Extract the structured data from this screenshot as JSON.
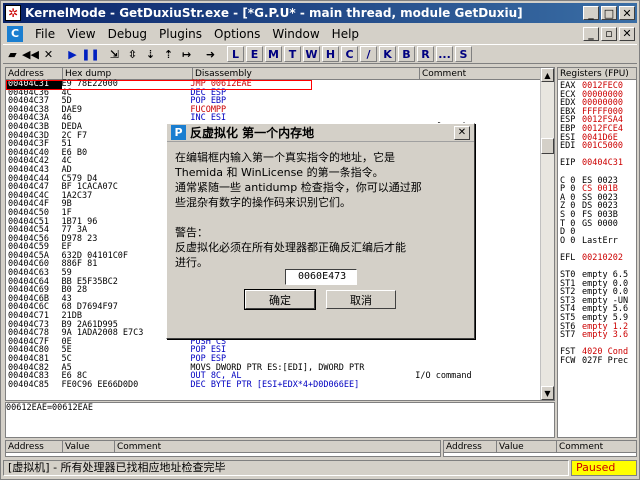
{
  "title": "KernelMode - GetDuxiuStr.exe - [*G.P.U* - main thread, module GetDuxiu]",
  "menu": [
    "File",
    "View",
    "Debug",
    "Plugins",
    "Options",
    "Window",
    "Help"
  ],
  "toolbar_letters": [
    "L",
    "E",
    "M",
    "T",
    "W",
    "H",
    "C",
    "/",
    "K",
    "B",
    "R",
    "...",
    "S"
  ],
  "cpu_headers": {
    "address": "Address",
    "hex": "Hex dump",
    "disasm": "Disassembly",
    "comment": "Comment"
  },
  "cpu_rows": [
    {
      "a": "00404C31",
      "h": "E9 78E22000",
      "d": "JMP 00612EAE",
      "c": "",
      "sel": true,
      "dc": "red"
    },
    {
      "a": "00404C36",
      "h": "4C",
      "d": "DEC ESP",
      "c": "",
      "dc": "blu"
    },
    {
      "a": "00404C37",
      "h": "5D",
      "d": "POP EBP",
      "c": "",
      "dc": "blu"
    },
    {
      "a": "00404C38",
      "h": "DAE9",
      "d": "FUCOMPP",
      "c": "",
      "dc": "red"
    },
    {
      "a": "00404C3A",
      "h": "46",
      "d": "INC ESI",
      "c": "",
      "dc": "blu"
    },
    {
      "a": "00404C3B",
      "h": "DEDA",
      "d": "",
      "c": "se of regi",
      "dc": ""
    },
    {
      "a": "00404C3D",
      "h": "2C F7",
      "d": "",
      "c": "",
      "dc": ""
    },
    {
      "a": "00404C3F",
      "h": "51",
      "d": "",
      "c": "",
      "dc": ""
    },
    {
      "a": "00404C40",
      "h": "E6 B0",
      "d": "",
      "c": "nd",
      "dc": ""
    },
    {
      "a": "00404C42",
      "h": "4C",
      "d": "",
      "c": "",
      "dc": ""
    },
    {
      "a": "00404C43",
      "h": "AD",
      "d": "",
      "c": "",
      "dc": ""
    },
    {
      "a": "00404C44",
      "h": "C579 D4",
      "d": "",
      "c": "ion of seg",
      "dc": ""
    },
    {
      "a": "00404C47",
      "h": "BF 1CACA07C",
      "d": "",
      "c": "",
      "dc": ""
    },
    {
      "a": "00404C4C",
      "h": "1A2C37",
      "d": "",
      "c": "ion of seg",
      "dc": ""
    },
    {
      "a": "00404C4F",
      "h": "9B",
      "d": "",
      "c": "",
      "dc": ""
    },
    {
      "a": "00404C50",
      "h": "1F",
      "d": "",
      "c": "",
      "dc": ""
    },
    {
      "a": "00404C51",
      "h": "1B71 96",
      "d": "",
      "c": "",
      "dc": ""
    },
    {
      "a": "00404C54",
      "h": "77 3A",
      "d": "",
      "c": "",
      "dc": ""
    },
    {
      "a": "00404C56",
      "h": "D978 23",
      "d": "",
      "c": "",
      "dc": ""
    },
    {
      "a": "00404C59",
      "h": "EF",
      "d": "",
      "c": "nd",
      "dc": ""
    },
    {
      "a": "00404C5A",
      "h": "632D 04101C0F",
      "d": "",
      "c": "",
      "dc": ""
    },
    {
      "a": "00404C60",
      "h": "886F 81",
      "d": "",
      "c": "",
      "dc": ""
    },
    {
      "a": "00404C63",
      "h": "59",
      "d": "",
      "c": "",
      "dc": ""
    },
    {
      "a": "00404C64",
      "h": "BB E5F35BC2",
      "d": "",
      "c": "",
      "dc": ""
    },
    {
      "a": "00404C69",
      "h": "B0 28",
      "d": "",
      "c": "",
      "dc": ""
    },
    {
      "a": "00404C6B",
      "h": "43",
      "d": "",
      "c": "",
      "dc": ""
    },
    {
      "a": "00404C6C",
      "h": "68 D7694F97",
      "d": "",
      "c": "",
      "dc": ""
    },
    {
      "a": "00404C71",
      "h": "21DB",
      "d": "",
      "c": "",
      "dc": ""
    },
    {
      "a": "00404C73",
      "h": "B9 2A61D995",
      "d": "",
      "c": "",
      "dc": ""
    },
    {
      "a": "00404C78",
      "h": "9A 1ADA2008 E7C3",
      "d": "CALL FAR C3E7:0820DA1A",
      "c": "Far call",
      "dc": "call"
    },
    {
      "a": "00404C7F",
      "h": "0E",
      "d": "PUSH CS",
      "c": "",
      "dc": "blu"
    },
    {
      "a": "00404C80",
      "h": "5E",
      "d": "POP ESI",
      "c": "",
      "dc": "blu"
    },
    {
      "a": "00404C81",
      "h": "5C",
      "d": "POP ESP",
      "c": "",
      "dc": "blu"
    },
    {
      "a": "00404C82",
      "h": "A5",
      "d": "MOVS DWORD PTR ES:[EDI], DWORD PTR",
      "c": "",
      "dc": ""
    },
    {
      "a": "00404C83",
      "h": "E6 8C",
      "d": "OUT 8C, AL",
      "c": "I/O command",
      "dc": "blu"
    },
    {
      "a": "00404C85",
      "h": "FE0C96 EE66D0D0",
      "d": "DEC BYTE PTR [ESI+EDX*4+D0D066EE]",
      "c": "",
      "dc": "blu"
    }
  ],
  "info_line": "00612EAE=00612EAE",
  "registers_title": "Registers (FPU)",
  "registers": [
    {
      "n": "EAX",
      "v": "0012FEC0",
      "color": "red"
    },
    {
      "n": "ECX",
      "v": "00000000",
      "color": "red"
    },
    {
      "n": "EDX",
      "v": "00000000",
      "color": "red"
    },
    {
      "n": "EBX",
      "v": "FFFFF000",
      "color": "red"
    },
    {
      "n": "ESP",
      "v": "0012FSA4",
      "color": "red"
    },
    {
      "n": "EBP",
      "v": "0012FCE4",
      "color": "red"
    },
    {
      "n": "ESI",
      "v": "0041D6E",
      "color": "red"
    },
    {
      "n": "EDI",
      "v": "001C5000",
      "color": "red"
    },
    {
      "n": "",
      "v": "",
      "color": ""
    },
    {
      "n": "EIP",
      "v": "00404C31",
      "color": "red"
    },
    {
      "n": "",
      "v": "",
      "color": ""
    },
    {
      "n": "C 0",
      "v": "ES 0023",
      "color": ""
    },
    {
      "n": "P 0",
      "v": "CS 001B",
      "color": "red"
    },
    {
      "n": "A 0",
      "v": "SS 0023",
      "color": ""
    },
    {
      "n": "Z 0",
      "v": "DS 0023",
      "color": ""
    },
    {
      "n": "S 0",
      "v": "FS 003B",
      "color": ""
    },
    {
      "n": "T 0",
      "v": "GS 0000",
      "color": ""
    },
    {
      "n": "D 0",
      "v": "",
      "color": ""
    },
    {
      "n": "O 0",
      "v": "LastErr",
      "color": ""
    },
    {
      "n": "",
      "v": "",
      "color": ""
    },
    {
      "n": "EFL",
      "v": "00210202",
      "color": "red"
    },
    {
      "n": "",
      "v": "",
      "color": ""
    },
    {
      "n": "ST0",
      "v": "empty 6.5",
      "color": ""
    },
    {
      "n": "ST1",
      "v": "empty 0.0",
      "color": ""
    },
    {
      "n": "ST2",
      "v": "empty 0.0",
      "color": ""
    },
    {
      "n": "ST3",
      "v": "empty -UN",
      "color": ""
    },
    {
      "n": "ST4",
      "v": "empty 5.6",
      "color": ""
    },
    {
      "n": "ST5",
      "v": "empty 5.9",
      "color": ""
    },
    {
      "n": "ST6",
      "v": "empty 1.2",
      "color": "red"
    },
    {
      "n": "ST7",
      "v": "empty 3.6",
      "color": "red"
    },
    {
      "n": "",
      "v": "",
      "color": ""
    },
    {
      "n": "FST",
      "v": "4020 Cond",
      "color": "red"
    },
    {
      "n": "FCW",
      "v": "027F Prec",
      "color": ""
    }
  ],
  "dump_headers": {
    "address": "Address",
    "value": "Value",
    "comment": "Comment"
  },
  "stack_headers": {
    "address": "Address",
    "value": "Value",
    "comment": "Comment"
  },
  "status": {
    "message": "[虚拟机] - 所有处理器已找相应地址检查完毕",
    "state": "Paused"
  },
  "dialog": {
    "title": "反虚拟化 第一个内存地",
    "text": "在编辑框内输入第一个真实指令的地址，它是\nThemida 和 WinLicense 的第一条指令。\n通常紧随一些 antidump 检查指令，你可以通过那\n些混杂有数字的操作码来识别它们。\n\n警告：\n反虚拟化必须在所有处理器都正确反汇编后才能\n进行。",
    "input_value": "0060E473",
    "ok_label": "确定",
    "cancel_label": "取消"
  },
  "colors": {
    "selection": "#000000",
    "highlight_box": "#ff0000",
    "paused_bg": "#ffff00",
    "paused_fg": "#cc0000"
  }
}
